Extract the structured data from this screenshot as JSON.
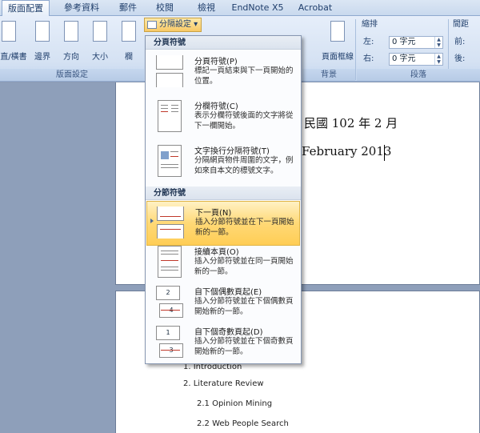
{
  "tabs": [
    "版面配置",
    "參考資料",
    "郵件",
    "校閱",
    "檢視",
    "EndNote X5",
    "Acrobat"
  ],
  "ribbon": {
    "buttons": [
      "直/橫書",
      "邊界",
      "方向",
      "大小",
      "欄"
    ],
    "page_setup_label": "分隔設定",
    "background_group": "背景",
    "page_border_label": "頁面框線",
    "layout_group": "版面設定",
    "indent_label": "縮排",
    "indent_left_label": "左:",
    "indent_left_value": "0 字元",
    "indent_right_label": "右:",
    "indent_right_value": "0 字元",
    "spacing_label": "間距",
    "spacing_before": "前:",
    "spacing_after": "後:",
    "paragraph_group": "段落"
  },
  "menu": {
    "page_breaks_header": "分頁符號",
    "section_breaks_header": "分節符號",
    "items": [
      {
        "title": "分頁符號(P)",
        "desc": "標記一頁結束與下一頁開始的位置。"
      },
      {
        "title": "分欄符號(C)",
        "desc": "表示分欄符號後面的文字將從下一欄開始。"
      },
      {
        "title": "文字換行分隔符號(T)",
        "desc": "分隔網頁物件周圍的文字，例如來自本文的標號文字。"
      },
      {
        "title": "下一頁(N)",
        "desc": "插入分節符號並在下一頁開始新的一節。"
      },
      {
        "title": "接續本頁(O)",
        "desc": "插入分節符號並在同一頁開始新的一節。"
      },
      {
        "title": "自下個偶數頁起(E)",
        "desc": "插入分節符號並在下個偶數頁開始新的一節。"
      },
      {
        "title": "自下個奇數頁起(D)",
        "desc": "插入分節符號並在下個奇數頁開始新的一節。"
      }
    ]
  },
  "document": {
    "date_zh": "民國 102 年 2 月",
    "date_en": "February 2013",
    "toc": [
      "1.  Introduction",
      "2.  Literature Review",
      "2.1 Opinion Mining",
      "2.2 Web People Search"
    ]
  },
  "colors": {
    "highlight": "#ffd976",
    "ribbon": "#d5e2f3"
  }
}
